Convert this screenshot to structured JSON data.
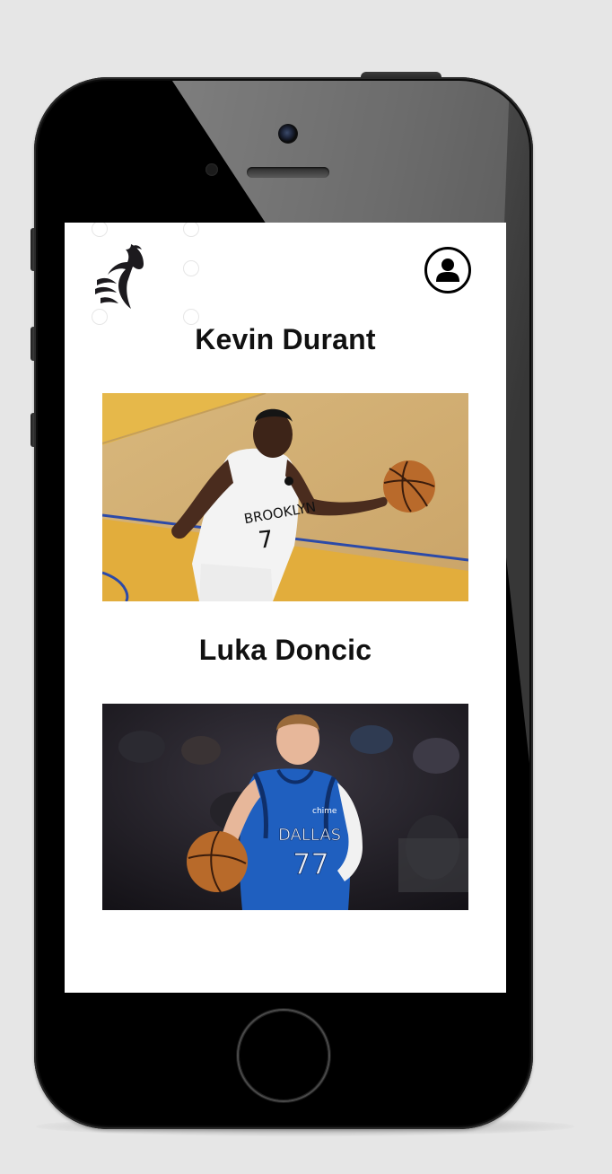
{
  "app": {
    "logo_icon": "goat-logo-icon",
    "profile_icon": "user-profile-icon"
  },
  "players": [
    {
      "name": "Kevin Durant",
      "jersey_team": "BROOKLYN",
      "jersey_number": "7",
      "jersey_color": "#f4f4f4",
      "court_color": "#e6b84a"
    },
    {
      "name": "Luka Doncic",
      "jersey_team": "DALLAS",
      "jersey_number": "77",
      "jersey_sponsor": "chime",
      "jersey_color": "#1f5fbf",
      "background_color": "#1c1a22"
    }
  ]
}
